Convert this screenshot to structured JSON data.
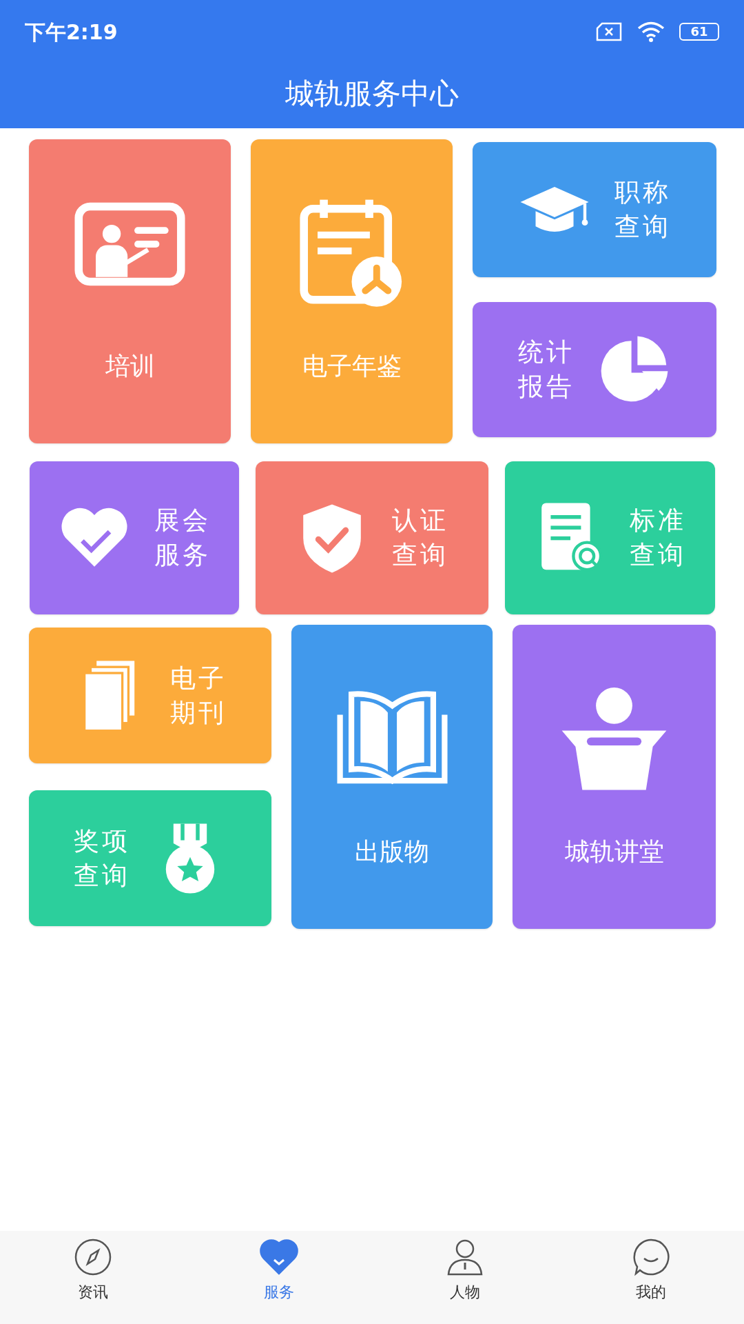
{
  "status_bar": {
    "time": "下午2:19",
    "battery": "61"
  },
  "header": {
    "title": "城轨服务中心"
  },
  "sections": [
    {
      "kind": "block-a",
      "tiles": [
        {
          "label": "培训",
          "kind": "tall",
          "color": "#f47c70"
        },
        {
          "label": "电子年鉴",
          "kind": "tall",
          "color": "#fcab3b"
        },
        {
          "label": "职称查询",
          "kind": "icon-left",
          "color": "#4199ec"
        },
        {
          "label": "统计报告",
          "kind": "icon-right",
          "color": "#9c70f1"
        }
      ]
    },
    {
      "kind": "row",
      "tiles": [
        {
          "label": "展会服务",
          "kind": "icon-left",
          "color": "#9c70f1"
        },
        {
          "label": "认证查询",
          "kind": "icon-left",
          "color": "#f47c70"
        },
        {
          "label": "标准查询",
          "kind": "icon-left",
          "color": "#2ccf9c"
        }
      ]
    },
    {
      "kind": "block-b",
      "tiles": [
        {
          "label": "电子期刊",
          "kind": "icon-left",
          "color": "#fcab3b"
        },
        {
          "label": "奖项查询",
          "kind": "icon-right",
          "color": "#2ccf9c"
        },
        {
          "label": "出版物",
          "kind": "tall",
          "color": "#4199ec"
        },
        {
          "label": "城轨讲堂",
          "kind": "tall",
          "color": "#9c70f1"
        }
      ]
    }
  ],
  "nav": [
    {
      "label": "资讯",
      "selected": false
    },
    {
      "label": "服务",
      "selected": true
    },
    {
      "label": "人物",
      "selected": false
    },
    {
      "label": "我的",
      "selected": false
    }
  ]
}
